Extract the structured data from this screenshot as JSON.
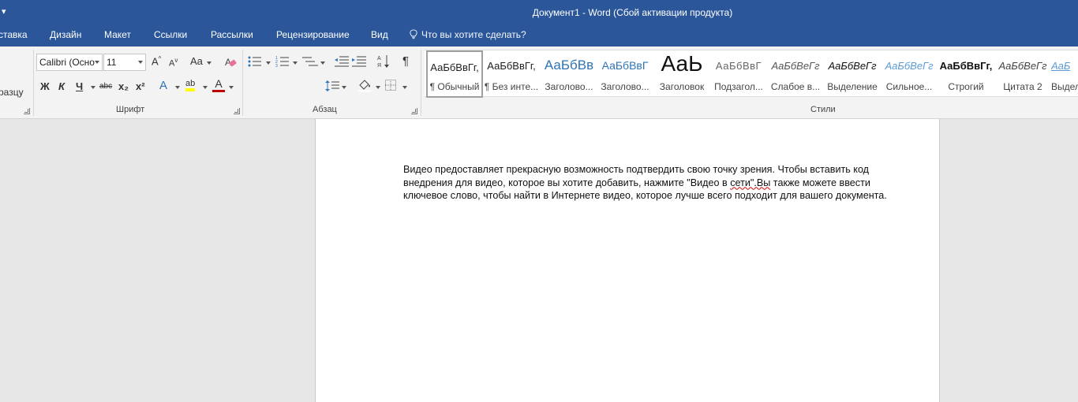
{
  "window": {
    "title": "Документ1 - Word (Сбой активации продукта)",
    "qat_icon": "customize-qat-arrow"
  },
  "tabs": [
    "ставка",
    "Дизайн",
    "Макет",
    "Ссылки",
    "Рассылки",
    "Рецензирование",
    "Вид"
  ],
  "tell_me": {
    "icon": "lightbulb-icon",
    "text": "Что вы хотите сделать?"
  },
  "ribbon": {
    "clipboard": {
      "format_painter_label": "разцу"
    },
    "font": {
      "group_label": "Шрифт",
      "font_name": "Calibri (Осно",
      "font_size": "11",
      "grow_font": "A",
      "shrink_font": "A",
      "change_case": "Aa",
      "bold": "Ж",
      "italic": "К",
      "underline": "Ч",
      "strikethrough": "abc",
      "subscript": "x₂",
      "superscript": "x²",
      "text_effects": "A",
      "highlight": "ab",
      "font_color": "A",
      "font_color_value": "#c00000",
      "highlight_color_value": "#ffff00"
    },
    "paragraph": {
      "group_label": "Абзац",
      "show_marks": "¶"
    },
    "styles": {
      "group_label": "Стили",
      "items": [
        {
          "preview": "АаБбВвГг,",
          "name": "¶ Обычный"
        },
        {
          "preview": "АаБбВвГг,",
          "name": "¶ Без инте..."
        },
        {
          "preview": "АаБбВв",
          "name": "Заголово..."
        },
        {
          "preview": "АаБбВвГ",
          "name": "Заголово..."
        },
        {
          "preview": "АаЬ",
          "name": "Заголовок"
        },
        {
          "preview": "АаБбВвГ",
          "name": "Подзагол..."
        },
        {
          "preview": "АаБбВеГг",
          "name": "Слабое в..."
        },
        {
          "preview": "АаБбВеГг",
          "name": "Выделение"
        },
        {
          "preview": "АаБбВеГг",
          "name": "Сильное..."
        },
        {
          "preview": "АаБбВвГг,",
          "name": "Строгий"
        },
        {
          "preview": "АаБбВеГг",
          "name": "Цитата 2"
        },
        {
          "preview": "АаБ",
          "name": "Выдел"
        }
      ]
    }
  },
  "document": {
    "before": "Видео предоставляет прекрасную возможность подтвердить свою точку зрения. Чтобы вставить код внедрения для видео, которое вы хотите добавить, нажмите \"Видео в ",
    "misspelled": "сети\".Вы",
    "after": " также можете ввести ключевое слово, чтобы найти в Интернете видео, которое лучше всего подходит для вашего документа."
  },
  "colors": {
    "accent": "#2b579a",
    "ribbon_bg": "#f3f3f3",
    "workspace_bg": "#e6e6e6",
    "heading_blue": "#2e74b5"
  }
}
